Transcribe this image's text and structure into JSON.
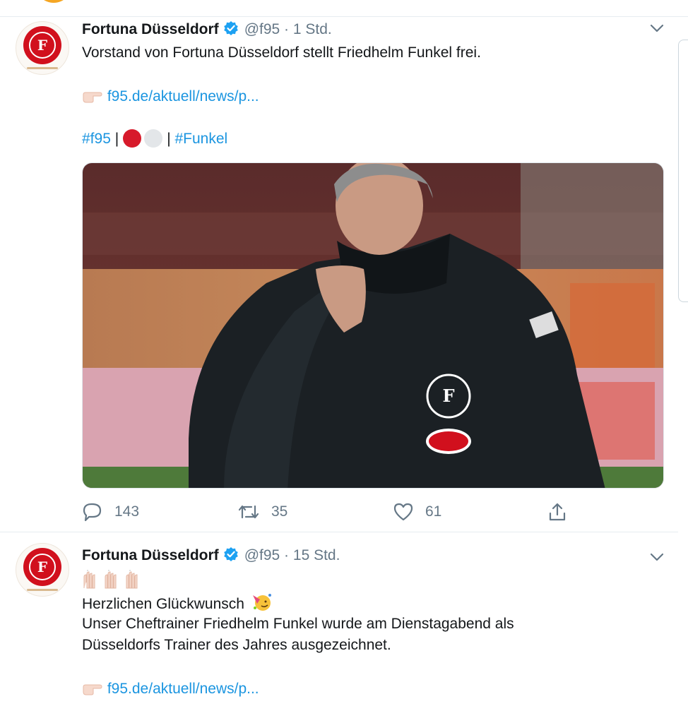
{
  "tweets": [
    {
      "author": {
        "name": "Fortuna Düsseldorf",
        "handle": "@f95",
        "separator": "·",
        "time": "1 Std."
      },
      "text_lines": [
        "Vorstand von Fortuna Düsseldorf stellt Friedhelm Funkel frei."
      ],
      "link": "f95.de/aktuell/news/p...",
      "hashtags": {
        "first": "#f95",
        "divider": "|",
        "second": "#Funkel"
      },
      "stats": {
        "replies": "143",
        "retweets": "35",
        "likes": "61"
      },
      "colors": {
        "club_red": "#d71a2b"
      }
    },
    {
      "author": {
        "name": "Fortuna Düsseldorf",
        "handle": "@f95",
        "separator": "·",
        "time": "15 Std."
      },
      "text_lines": [
        "Herzlichen Glückwunsch",
        "Unser Cheftrainer Friedhelm Funkel wurde am Dienstagabend als",
        "Düsseldorfs Trainer des Jahres ausgezeichnet."
      ],
      "link": "f95.de/aktuell/news/p..."
    }
  ],
  "icons": {
    "verified": "verified-badge-icon",
    "chevron": "chevron-down-icon",
    "reply": "reply-icon",
    "retweet": "retweet-icon",
    "like": "heart-icon",
    "share": "share-icon",
    "link_hand": "pointing-hand-icon",
    "clap": "clapping-hands-icon",
    "party": "party-face-icon"
  },
  "colors": {
    "link": "#1b95e0",
    "muted": "#657786",
    "verified": "#1da1f2",
    "brand_red": "#d1101d"
  }
}
